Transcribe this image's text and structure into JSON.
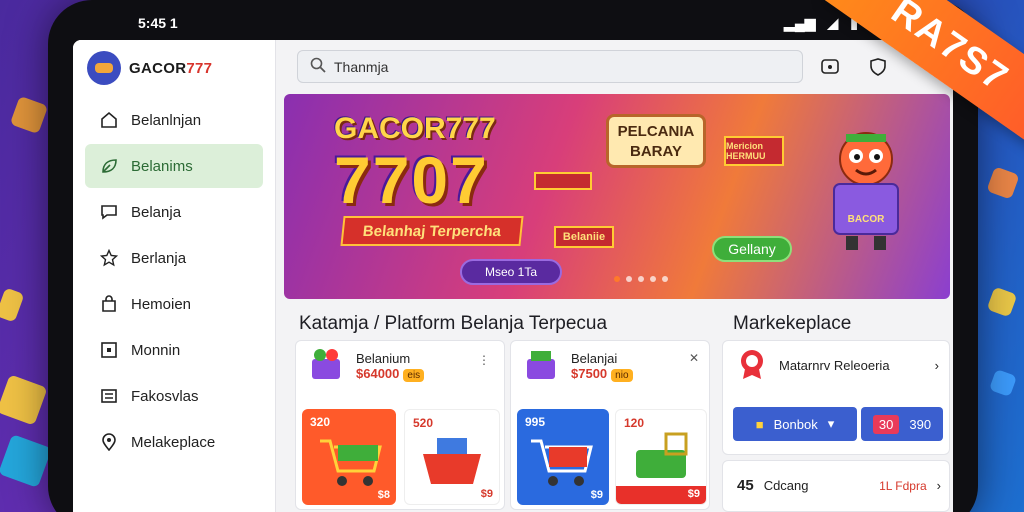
{
  "status": {
    "time": "5:45 1"
  },
  "brand": {
    "name_prefix": "GACOR",
    "name_suffix": "777"
  },
  "sidebar": {
    "items": [
      {
        "label": "Belanlnjan",
        "icon": "home-icon"
      },
      {
        "label": "Belanims",
        "icon": "leaf-icon"
      },
      {
        "label": "Belanja",
        "icon": "chat-icon"
      },
      {
        "label": "Berlanja",
        "icon": "star-icon"
      },
      {
        "label": "Hemoien",
        "icon": "bag-icon"
      },
      {
        "label": "Monnin",
        "icon": "square-icon"
      },
      {
        "label": "Fakosvlas",
        "icon": "list-icon"
      },
      {
        "label": "Melakeplace",
        "icon": "pin-icon"
      }
    ]
  },
  "search": {
    "placeholder": "Thanmja"
  },
  "banner": {
    "title": "GACOR777",
    "big": "7707",
    "ribbon": "Belanhaj Terpercha",
    "pill": "Mseo 1Ta",
    "bubble_line1": "PELCANIA",
    "bubble_line2": "BARAY",
    "sign_right": "Mericion HERMUU",
    "sign_mid": "Belaniie",
    "green_btn": "Gellany",
    "mascot_label": "BACOR"
  },
  "catalog": {
    "title": "Katamja / Platform Belanja Terpecua",
    "products": [
      {
        "name": "Belanium",
        "price": "$64000",
        "tag": "eis"
      },
      {
        "name": "Belanjai",
        "price": "$7500",
        "tag": "nio"
      }
    ],
    "tiles": [
      {
        "num": "320",
        "price": "$8",
        "color": "#ff5a2a"
      },
      {
        "num": "520",
        "price": "$9",
        "color": "#ffffff"
      },
      {
        "num": "995",
        "price": "$9",
        "color": "#2a6adf"
      },
      {
        "num": "120",
        "price": "$9",
        "color": "#ffffff"
      }
    ]
  },
  "marketplace": {
    "title": "Markekeplace",
    "item_label": "Matarnrv Releoeria",
    "btn1": "Bonbok",
    "btn2_left": "30",
    "btn2_right": "390",
    "row_num": "45",
    "row_label": "Cdcang",
    "row_right": "1L Fdpra"
  },
  "corner": {
    "text": "RA7S7"
  },
  "colors": {
    "accent": "#d8342c",
    "active_bg": "#dcefd9",
    "banner_orange": "#f07a3a",
    "blue_btn": "#3b5fcf"
  }
}
